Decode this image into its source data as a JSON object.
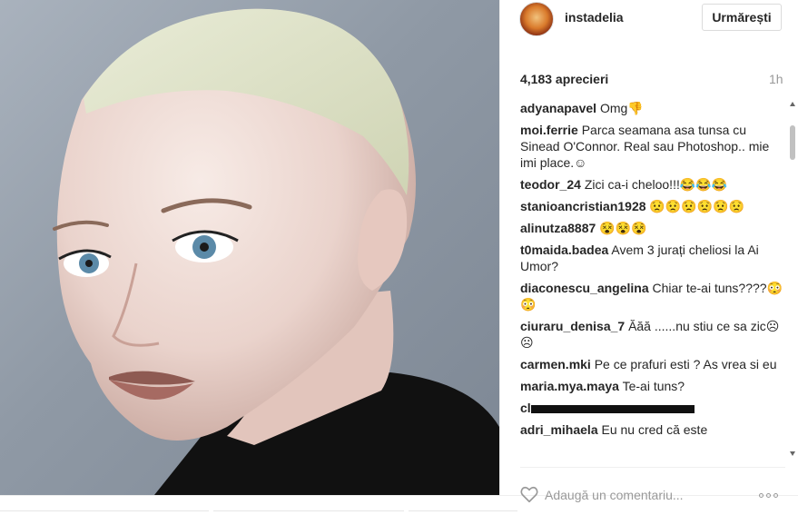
{
  "post": {
    "username": "instadelia",
    "follow_label": "Urmărești",
    "likes": "4,183 aprecieri",
    "timestamp": "1h"
  },
  "comments": [
    {
      "user": "adyanapavel",
      "text": "Omg👎"
    },
    {
      "user": "moi.ferrie",
      "text": "Parca seamana asa tunsa cu Sinead O'Connor. Real sau Photoshop.. mie imi place.☺"
    },
    {
      "user": "teodor_24",
      "text": "Zici ca-i cheloo!!!😂😂😂"
    },
    {
      "user": "stanioancristian1928",
      "text": "😟😟😟😟😟😟"
    },
    {
      "user": "alinutza8887",
      "text": "😵😵😵"
    },
    {
      "user": "t0maida.badea",
      "text": "Avem 3 jurați cheliosi la Ai Umor?"
    },
    {
      "user": "diaconescu_angelina",
      "text": "Chiar te-ai tuns????😳😳"
    },
    {
      "user": "ciuraru_denisa_7",
      "text": "Ăăă ......nu stiu ce sa zic☹☹"
    },
    {
      "user": "carmen.mki",
      "text": "Pe ce prafuri esti ? As vrea si eu"
    },
    {
      "user": "maria.mya.maya",
      "text": "Te-ai tuns?"
    },
    {
      "user": "cl",
      "text": "",
      "redacted": true
    },
    {
      "user": "adri_mihaela",
      "text": "Eu nu cred că este"
    }
  ],
  "input": {
    "placeholder": "Adaugă un comentariu..."
  },
  "icons": {
    "like": "heart-icon",
    "options": "more-options-icon",
    "scroll_up": "scroll-up-arrow-icon",
    "scroll_down": "scroll-down-arrow-icon"
  }
}
